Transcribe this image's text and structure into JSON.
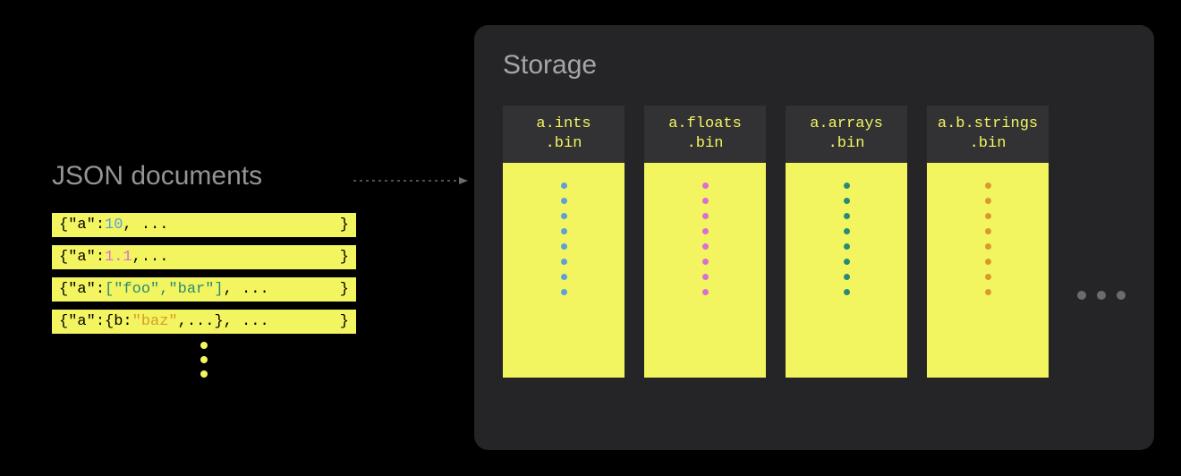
{
  "left": {
    "title": "JSON documents",
    "rows": [
      {
        "tokens": [
          {
            "t": "{",
            "c": "punc"
          },
          {
            "t": "\"a\"",
            "c": "key"
          },
          {
            "t": ":",
            "c": "punc"
          },
          {
            "t": "10",
            "c": "int"
          },
          {
            "t": ", ...",
            "c": "punc"
          }
        ],
        "closer": "}"
      },
      {
        "tokens": [
          {
            "t": "{",
            "c": "punc"
          },
          {
            "t": "\"a\"",
            "c": "key"
          },
          {
            "t": ":",
            "c": "punc"
          },
          {
            "t": "1.1",
            "c": "float"
          },
          {
            "t": ",...",
            "c": "punc"
          }
        ],
        "closer": "}"
      },
      {
        "tokens": [
          {
            "t": "{",
            "c": "punc"
          },
          {
            "t": "\"a\"",
            "c": "key"
          },
          {
            "t": ":",
            "c": "punc"
          },
          {
            "t": "[\"foo\",\"bar\"]",
            "c": "array"
          },
          {
            "t": ", ...",
            "c": "punc"
          }
        ],
        "closer": "}"
      },
      {
        "tokens": [
          {
            "t": "{",
            "c": "punc"
          },
          {
            "t": "\"a\"",
            "c": "key"
          },
          {
            "t": ":{b:",
            "c": "punc"
          },
          {
            "t": "\"baz\"",
            "c": "str"
          },
          {
            "t": ",...}, ...",
            "c": "punc"
          }
        ],
        "closer": "}"
      }
    ]
  },
  "storage": {
    "title": "Storage",
    "columns": [
      {
        "name": "a.ints\n.bin",
        "dot": "int"
      },
      {
        "name": "a.floats\n.bin",
        "dot": "float"
      },
      {
        "name": "a.arrays\n.bin",
        "dot": "array"
      },
      {
        "name": "a.b.strings\n.bin",
        "dot": "str"
      }
    ]
  }
}
